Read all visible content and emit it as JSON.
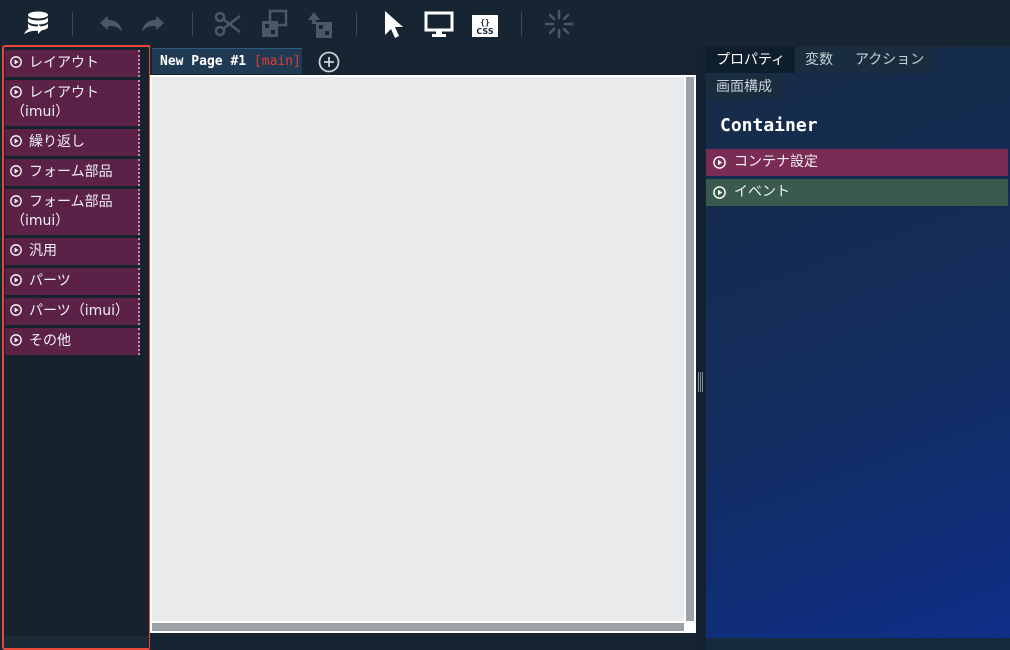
{
  "toolbar": {
    "icons": [
      "database-icon",
      "undo-icon",
      "redo-icon",
      "cut-icon",
      "copy-icon",
      "paste-icon",
      "select-pointer-icon",
      "preview-monitor-icon",
      "css-icon",
      "loading-spinner-icon"
    ],
    "css_label": "{}",
    "css_sub": "CSS"
  },
  "palette": {
    "items": [
      {
        "label": "レイアウト",
        "sub": ""
      },
      {
        "label": "レイアウト",
        "sub": "（imui）"
      },
      {
        "label": "繰り返し",
        "sub": ""
      },
      {
        "label": "フォーム部品",
        "sub": ""
      },
      {
        "label": "フォーム部品",
        "sub": "（imui）"
      },
      {
        "label": "汎用",
        "sub": ""
      },
      {
        "label": "パーツ",
        "sub": ""
      },
      {
        "label": "パーツ（imui）",
        "sub": ""
      },
      {
        "label": "その他",
        "sub": ""
      }
    ]
  },
  "editor": {
    "tab_name": "New Page #1",
    "tab_branch": "[main]"
  },
  "properties": {
    "tabs": [
      "プロパティ",
      "変数",
      "アクション"
    ],
    "subtab": "画面構成",
    "component": "Container",
    "sections": [
      "コンテナ設定",
      "イベント"
    ]
  },
  "colors": {
    "toolbar_bg": "#172533",
    "palette_item": "#5b2146",
    "highlight_border": "#e8483a",
    "section_container": "#7a2c55",
    "section_event": "#3a5a4e",
    "branch_red": "#e53935"
  }
}
